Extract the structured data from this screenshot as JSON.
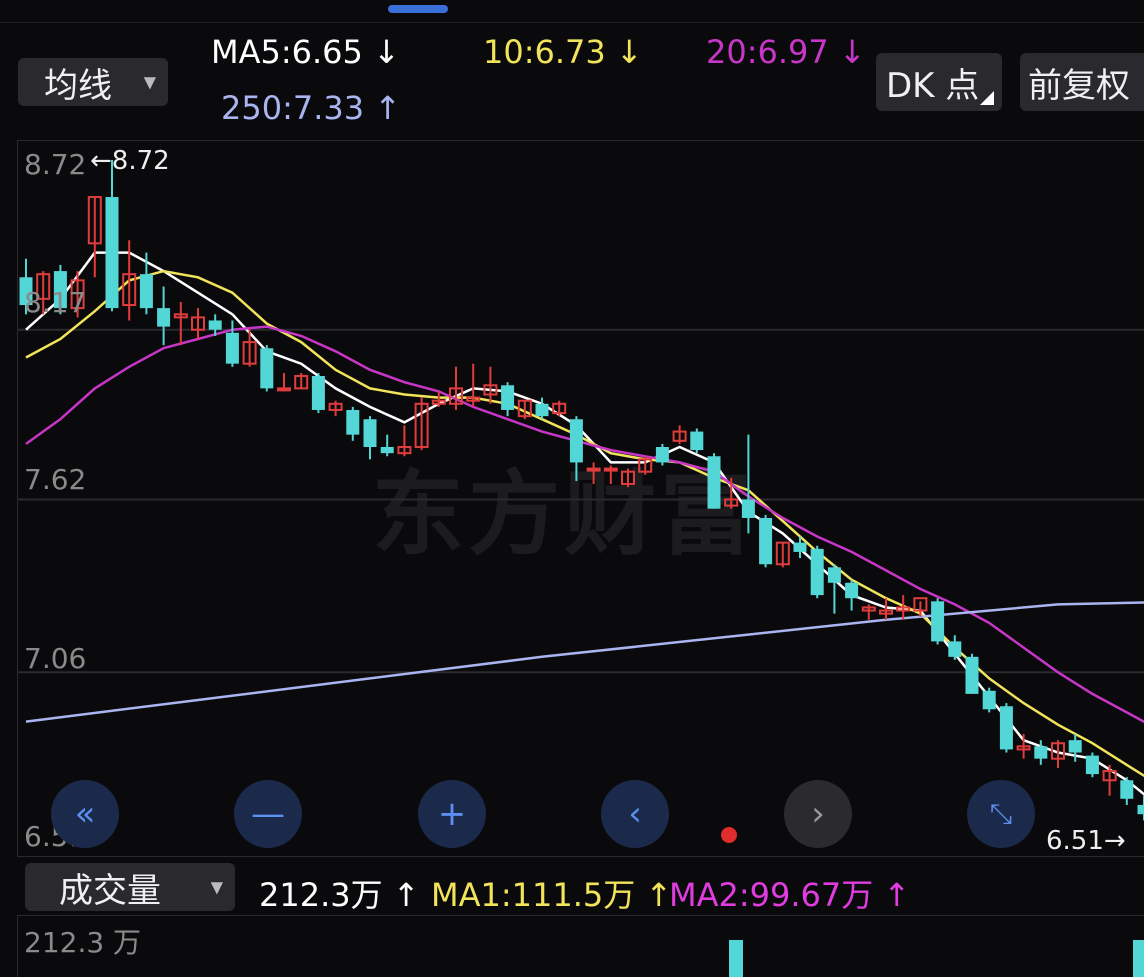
{
  "header": {
    "ma_type_label": "均线",
    "ma5": "MA5:6.65 ↓",
    "ma10": "10:6.73 ↓",
    "ma20": "20:6.97 ↓",
    "ma250": "250:7.33 ↑",
    "dk_label": "DK 点",
    "adjust_label": "前复权"
  },
  "colors": {
    "up": "#e03c3c",
    "down": "#52d6d6",
    "ma5": "#ffffff",
    "ma10": "#f2e45a",
    "ma20": "#c736c7",
    "ma250": "#a9b4f0",
    "accent": "#3b6fd8"
  },
  "price_axis": {
    "labels": [
      "8.72",
      "8.17",
      "7.62",
      "7.06",
      "6.51"
    ],
    "high_marker": "←8.72",
    "low_marker": "6.51→"
  },
  "controls": {
    "icons": [
      "double-left-icon",
      "minus-icon",
      "plus-icon",
      "chevron-left-icon",
      "chevron-right-icon",
      "expand-icon"
    ]
  },
  "watermark": "东方财富",
  "volume": {
    "indicator_label": "成交量",
    "value": "212.3万 ↑",
    "ma1": "MA1:111.5万 ↑",
    "ma2": "MA2:99.67万 ↑",
    "axis_max": "212.3 万"
  },
  "chart_data": {
    "type": "candlestick",
    "y_axis": {
      "ylim": [
        6.51,
        8.72
      ],
      "ticks": [
        8.72,
        8.17,
        7.62,
        7.06,
        6.51
      ]
    },
    "candles": [
      {
        "o": 8.34,
        "h": 8.4,
        "l": 8.22,
        "c": 8.25
      },
      {
        "o": 8.27,
        "h": 8.36,
        "l": 8.22,
        "c": 8.35
      },
      {
        "o": 8.36,
        "h": 8.38,
        "l": 8.22,
        "c": 8.24
      },
      {
        "o": 8.24,
        "h": 8.36,
        "l": 8.21,
        "c": 8.33
      },
      {
        "o": 8.45,
        "h": 8.6,
        "l": 8.34,
        "c": 8.6
      },
      {
        "o": 8.6,
        "h": 8.72,
        "l": 8.23,
        "c": 8.24
      },
      {
        "o": 8.25,
        "h": 8.46,
        "l": 8.2,
        "c": 8.35
      },
      {
        "o": 8.35,
        "h": 8.42,
        "l": 8.22,
        "c": 8.24
      },
      {
        "o": 8.24,
        "h": 8.31,
        "l": 8.12,
        "c": 8.18
      },
      {
        "o": 8.21,
        "h": 8.26,
        "l": 8.12,
        "c": 8.22
      },
      {
        "o": 8.17,
        "h": 8.24,
        "l": 8.14,
        "c": 8.21
      },
      {
        "o": 8.2,
        "h": 8.22,
        "l": 8.15,
        "c": 8.17
      },
      {
        "o": 8.16,
        "h": 8.2,
        "l": 8.05,
        "c": 8.06
      },
      {
        "o": 8.06,
        "h": 8.17,
        "l": 8.05,
        "c": 8.13
      },
      {
        "o": 8.11,
        "h": 8.12,
        "l": 7.97,
        "c": 7.98
      },
      {
        "o": 7.98,
        "h": 8.03,
        "l": 7.97,
        "c": 7.98
      },
      {
        "o": 7.98,
        "h": 8.03,
        "l": 7.98,
        "c": 8.02
      },
      {
        "o": 8.02,
        "h": 8.03,
        "l": 7.9,
        "c": 7.91
      },
      {
        "o": 7.91,
        "h": 7.94,
        "l": 7.89,
        "c": 7.93
      },
      {
        "o": 7.91,
        "h": 7.92,
        "l": 7.81,
        "c": 7.83
      },
      {
        "o": 7.88,
        "h": 7.89,
        "l": 7.75,
        "c": 7.79
      },
      {
        "o": 7.79,
        "h": 7.83,
        "l": 7.76,
        "c": 7.77
      },
      {
        "o": 7.77,
        "h": 7.86,
        "l": 7.76,
        "c": 7.79
      },
      {
        "o": 7.79,
        "h": 7.95,
        "l": 7.78,
        "c": 7.93
      },
      {
        "o": 7.93,
        "h": 7.97,
        "l": 7.92,
        "c": 7.94
      },
      {
        "o": 7.93,
        "h": 8.05,
        "l": 7.91,
        "c": 7.98
      },
      {
        "o": 7.94,
        "h": 8.06,
        "l": 7.92,
        "c": 7.95
      },
      {
        "o": 7.96,
        "h": 8.05,
        "l": 7.93,
        "c": 7.99
      },
      {
        "o": 7.99,
        "h": 8.0,
        "l": 7.89,
        "c": 7.91
      },
      {
        "o": 7.89,
        "h": 7.94,
        "l": 7.88,
        "c": 7.94
      },
      {
        "o": 7.93,
        "h": 7.95,
        "l": 7.88,
        "c": 7.89
      },
      {
        "o": 7.9,
        "h": 7.94,
        "l": 7.89,
        "c": 7.93
      },
      {
        "o": 7.88,
        "h": 7.89,
        "l": 7.68,
        "c": 7.74
      },
      {
        "o": 7.72,
        "h": 7.74,
        "l": 7.67,
        "c": 7.72
      },
      {
        "o": 7.72,
        "h": 7.73,
        "l": 7.67,
        "c": 7.72
      },
      {
        "o": 7.67,
        "h": 7.72,
        "l": 7.66,
        "c": 7.71
      },
      {
        "o": 7.71,
        "h": 7.76,
        "l": 7.7,
        "c": 7.75
      },
      {
        "o": 7.79,
        "h": 7.8,
        "l": 7.73,
        "c": 7.74
      },
      {
        "o": 7.81,
        "h": 7.86,
        "l": 7.8,
        "c": 7.84
      },
      {
        "o": 7.84,
        "h": 7.85,
        "l": 7.77,
        "c": 7.78
      },
      {
        "o": 7.76,
        "h": 7.77,
        "l": 7.59,
        "c": 7.59
      },
      {
        "o": 7.6,
        "h": 7.69,
        "l": 7.59,
        "c": 7.62
      },
      {
        "o": 7.62,
        "h": 7.83,
        "l": 7.51,
        "c": 7.56
      },
      {
        "o": 7.56,
        "h": 7.57,
        "l": 7.4,
        "c": 7.41
      },
      {
        "o": 7.41,
        "h": 7.48,
        "l": 7.4,
        "c": 7.48
      },
      {
        "o": 7.48,
        "h": 7.5,
        "l": 7.43,
        "c": 7.45
      },
      {
        "o": 7.46,
        "h": 7.47,
        "l": 7.3,
        "c": 7.31
      },
      {
        "o": 7.4,
        "h": 7.41,
        "l": 7.25,
        "c": 7.35
      },
      {
        "o": 7.35,
        "h": 7.36,
        "l": 7.26,
        "c": 7.3
      },
      {
        "o": 7.26,
        "h": 7.28,
        "l": 7.23,
        "c": 7.27
      },
      {
        "o": 7.25,
        "h": 7.3,
        "l": 7.23,
        "c": 7.26
      },
      {
        "o": 7.26,
        "h": 7.31,
        "l": 7.23,
        "c": 7.27
      },
      {
        "o": 7.26,
        "h": 7.29,
        "l": 7.24,
        "c": 7.3
      },
      {
        "o": 7.29,
        "h": 7.3,
        "l": 7.15,
        "c": 7.16
      },
      {
        "o": 7.16,
        "h": 7.18,
        "l": 7.1,
        "c": 7.11
      },
      {
        "o": 7.11,
        "h": 7.12,
        "l": 6.99,
        "c": 6.99
      },
      {
        "o": 7.0,
        "h": 7.01,
        "l": 6.93,
        "c": 6.94
      },
      {
        "o": 6.95,
        "h": 6.96,
        "l": 6.8,
        "c": 6.81
      },
      {
        "o": 6.81,
        "h": 6.86,
        "l": 6.78,
        "c": 6.82
      },
      {
        "o": 6.82,
        "h": 6.84,
        "l": 6.76,
        "c": 6.78
      },
      {
        "o": 6.78,
        "h": 6.84,
        "l": 6.75,
        "c": 6.83
      },
      {
        "o": 6.84,
        "h": 6.86,
        "l": 6.77,
        "c": 6.8
      },
      {
        "o": 6.79,
        "h": 6.8,
        "l": 6.72,
        "c": 6.73
      },
      {
        "o": 6.71,
        "h": 6.76,
        "l": 6.66,
        "c": 6.74
      },
      {
        "o": 6.71,
        "h": 6.72,
        "l": 6.63,
        "c": 6.65
      },
      {
        "o": 6.63,
        "h": 6.66,
        "l": 6.58,
        "c": 6.6
      },
      {
        "o": 6.56,
        "h": 6.57,
        "l": 6.51,
        "c": 6.53
      },
      {
        "o": 6.54,
        "h": 6.56,
        "l": 6.51,
        "c": 6.51
      }
    ],
    "ma_lines": [
      {
        "name": "MA5",
        "color": "#ffffff",
        "points": [
          [
            0,
            8.17
          ],
          [
            2,
            8.27
          ],
          [
            4,
            8.42
          ],
          [
            6,
            8.42
          ],
          [
            8,
            8.36
          ],
          [
            10,
            8.29
          ],
          [
            12,
            8.22
          ],
          [
            14,
            8.1
          ],
          [
            16,
            8.06
          ],
          [
            18,
            7.98
          ],
          [
            20,
            7.92
          ],
          [
            22,
            7.87
          ],
          [
            24,
            7.93
          ],
          [
            26,
            7.98
          ],
          [
            28,
            7.97
          ],
          [
            30,
            7.93
          ],
          [
            32,
            7.86
          ],
          [
            34,
            7.74
          ],
          [
            36,
            7.74
          ],
          [
            38,
            7.79
          ],
          [
            40,
            7.74
          ],
          [
            42,
            7.58
          ],
          [
            44,
            7.51
          ],
          [
            46,
            7.41
          ],
          [
            48,
            7.31
          ],
          [
            50,
            7.27
          ],
          [
            52,
            7.26
          ],
          [
            54,
            7.12
          ],
          [
            56,
            6.98
          ],
          [
            58,
            6.84
          ],
          [
            60,
            6.8
          ],
          [
            62,
            6.78
          ],
          [
            64,
            6.71
          ],
          [
            66,
            6.62
          ],
          [
            68,
            6.55
          ]
        ]
      },
      {
        "name": "MA10",
        "color": "#f2e45a",
        "points": [
          [
            0,
            8.08
          ],
          [
            2,
            8.14
          ],
          [
            4,
            8.23
          ],
          [
            6,
            8.33
          ],
          [
            8,
            8.36
          ],
          [
            10,
            8.34
          ],
          [
            12,
            8.29
          ],
          [
            14,
            8.19
          ],
          [
            16,
            8.13
          ],
          [
            18,
            8.04
          ],
          [
            20,
            7.98
          ],
          [
            22,
            7.96
          ],
          [
            24,
            7.95
          ],
          [
            26,
            7.95
          ],
          [
            28,
            7.93
          ],
          [
            30,
            7.88
          ],
          [
            32,
            7.83
          ],
          [
            34,
            7.77
          ],
          [
            36,
            7.75
          ],
          [
            38,
            7.74
          ],
          [
            40,
            7.69
          ],
          [
            42,
            7.65
          ],
          [
            44,
            7.55
          ],
          [
            46,
            7.45
          ],
          [
            48,
            7.36
          ],
          [
            50,
            7.3
          ],
          [
            52,
            7.25
          ],
          [
            54,
            7.14
          ],
          [
            56,
            7.04
          ],
          [
            58,
            6.96
          ],
          [
            60,
            6.89
          ],
          [
            62,
            6.83
          ],
          [
            64,
            6.76
          ],
          [
            66,
            6.69
          ],
          [
            68,
            6.6
          ]
        ]
      },
      {
        "name": "MA20",
        "color": "#c736c7",
        "points": [
          [
            0,
            7.8
          ],
          [
            2,
            7.88
          ],
          [
            4,
            7.98
          ],
          [
            6,
            8.05
          ],
          [
            8,
            8.11
          ],
          [
            10,
            8.14
          ],
          [
            12,
            8.17
          ],
          [
            14,
            8.18
          ],
          [
            16,
            8.15
          ],
          [
            18,
            8.1
          ],
          [
            20,
            8.04
          ],
          [
            22,
            8.0
          ],
          [
            24,
            7.97
          ],
          [
            26,
            7.92
          ],
          [
            28,
            7.88
          ],
          [
            30,
            7.84
          ],
          [
            32,
            7.81
          ],
          [
            34,
            7.78
          ],
          [
            36,
            7.76
          ],
          [
            38,
            7.74
          ],
          [
            40,
            7.71
          ],
          [
            42,
            7.63
          ],
          [
            44,
            7.56
          ],
          [
            46,
            7.5
          ],
          [
            48,
            7.45
          ],
          [
            50,
            7.39
          ],
          [
            52,
            7.33
          ],
          [
            54,
            7.28
          ],
          [
            56,
            7.22
          ],
          [
            58,
            7.14
          ],
          [
            60,
            7.06
          ],
          [
            62,
            6.99
          ],
          [
            64,
            6.93
          ],
          [
            66,
            6.87
          ],
          [
            68,
            6.8
          ]
        ]
      },
      {
        "name": "MA250",
        "color": "#a9b4f0",
        "points": [
          [
            0,
            6.9
          ],
          [
            10,
            6.97
          ],
          [
            20,
            7.04
          ],
          [
            30,
            7.11
          ],
          [
            40,
            7.17
          ],
          [
            50,
            7.23
          ],
          [
            60,
            7.28
          ],
          [
            68,
            7.29
          ]
        ]
      }
    ],
    "volume_bars": [
      {
        "index": 40,
        "value": 212.3,
        "dir": "down"
      },
      {
        "index": 68,
        "value": 212.3,
        "dir": "down"
      }
    ],
    "volume_ylim": [
      0,
      212.3
    ]
  }
}
